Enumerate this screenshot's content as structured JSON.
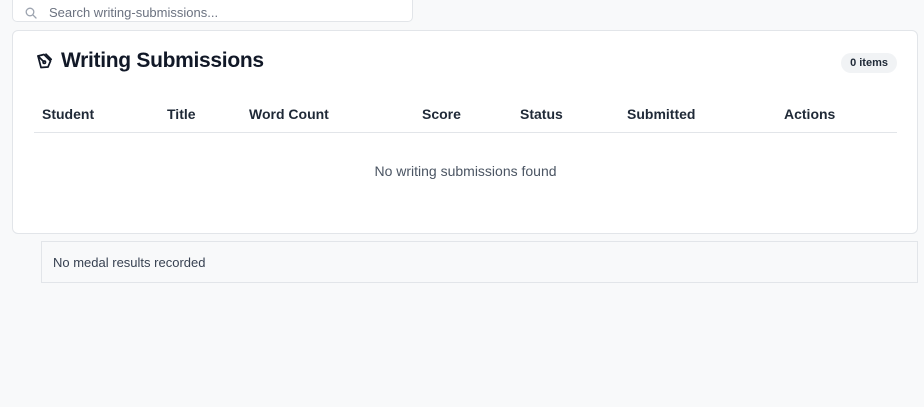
{
  "search": {
    "placeholder": "Search writing-submissions..."
  },
  "panel": {
    "title": "Writing Submissions",
    "count_badge": "0 items",
    "icon": "pen-tool-icon"
  },
  "table": {
    "columns": [
      "Student",
      "Title",
      "Word Count",
      "Score",
      "Status",
      "Submitted",
      "Actions"
    ],
    "rows": [],
    "empty_message": "No writing submissions found"
  },
  "medals": {
    "empty_message": "No medal results recorded"
  }
}
